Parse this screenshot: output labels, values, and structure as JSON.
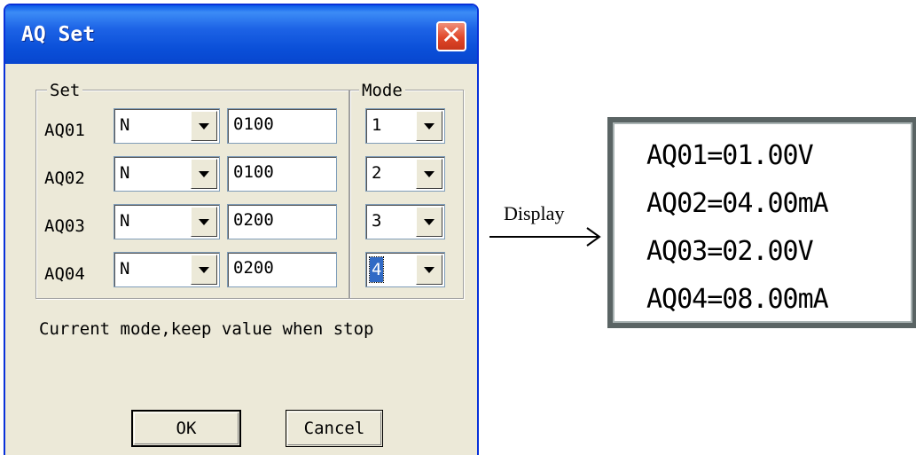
{
  "dialog": {
    "title": "AQ Set",
    "close_glyph": "✕",
    "set_group_label": "Set",
    "mode_group_label": "Mode",
    "rows": [
      {
        "label": "AQ01",
        "type": "N",
        "value": "0100",
        "mode": "1"
      },
      {
        "label": "AQ02",
        "type": "N",
        "value": "0100",
        "mode": "2"
      },
      {
        "label": "AQ03",
        "type": "N",
        "value": "0200",
        "mode": "3"
      },
      {
        "label": "AQ04",
        "type": "N",
        "value": "0200",
        "mode": "4"
      }
    ],
    "status_text": "Current mode,keep value when stop",
    "ok_label": "OK",
    "cancel_label": "Cancel"
  },
  "arrow_label": "Display",
  "display": {
    "lines": [
      "AQ01=01.00V",
      "AQ02=04.00mA",
      "AQ03=02.00V",
      "AQ04=08.00mA"
    ]
  },
  "colors": {
    "titlebar": "#0a4fd8",
    "close_button": "#e0472a",
    "window_face": "#ece9d8",
    "selection": "#316ac5"
  },
  "icons": {
    "close": "close-icon",
    "dropdown": "chevron-down-icon",
    "arrow": "arrow-right-icon"
  }
}
